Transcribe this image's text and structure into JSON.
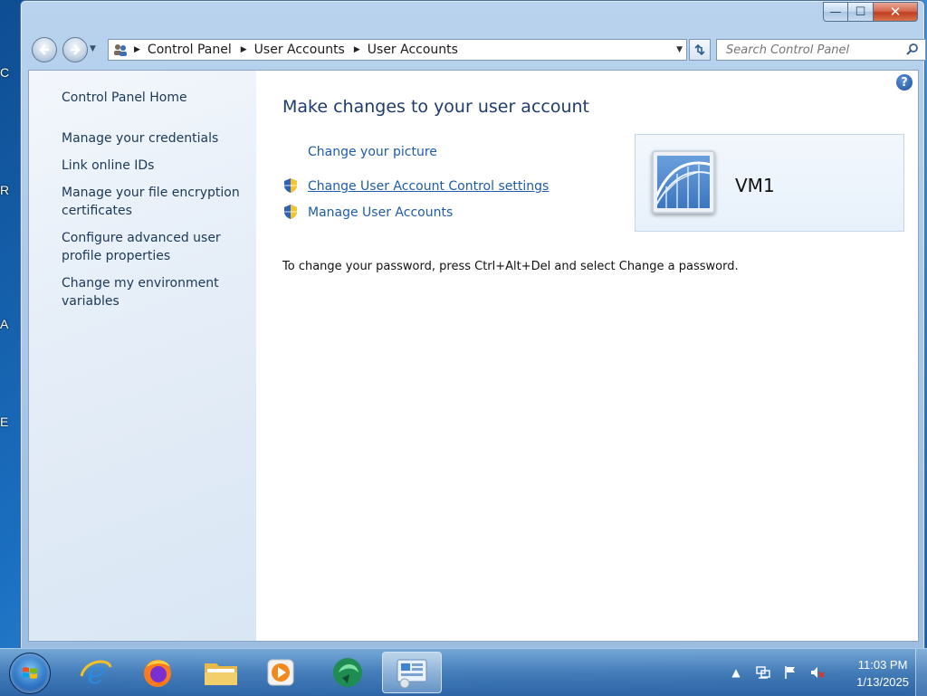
{
  "desktop": {
    "fragments": [
      "C",
      "R",
      "A",
      "E"
    ]
  },
  "window": {
    "caption": {
      "minimize": "—",
      "maximize": "☐",
      "close": "✕"
    }
  },
  "navbar": {
    "breadcrumbs": [
      "Control Panel",
      "User Accounts",
      "User Accounts"
    ],
    "search_placeholder": "Search Control Panel"
  },
  "sidebar": {
    "items": [
      "Control Panel Home",
      "Manage your credentials",
      "Link online IDs",
      "Manage your file encryption certificates",
      "Configure advanced user profile properties",
      "Change my environment variables"
    ]
  },
  "main": {
    "heading": "Make changes to your user account",
    "tasks": {
      "change_picture": "Change your picture",
      "uac_settings": "Change User Account Control settings",
      "manage_accounts": "Manage User Accounts"
    },
    "password_note": "To change your password, press Ctrl+Alt+Del and select Change a password.",
    "user": {
      "name": "VM1"
    }
  },
  "taskbar": {
    "apps": [
      "internet-explorer",
      "firefox",
      "file-explorer",
      "media-player",
      "app-green",
      "control-panel"
    ],
    "clock": {
      "time": "11:03 PM",
      "date": "1/13/2025"
    }
  }
}
